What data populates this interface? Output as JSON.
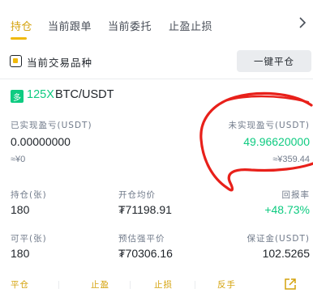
{
  "tabs": [
    {
      "label": "持仓"
    },
    {
      "label": "当前跟单"
    },
    {
      "label": "当前委托"
    },
    {
      "label": "止盈止损"
    }
  ],
  "filter": {
    "label": "当前交易品种",
    "close_all_label": "一键平仓"
  },
  "position": {
    "side_badge": "多",
    "leverage": "125X",
    "symbol": "BTC/USDT",
    "realized_pnl_label": "已实现盈亏(USDT)",
    "realized_pnl_value": "0.00000000",
    "realized_pnl_cny": "≈¥0",
    "unrealized_pnl_label": "未实现盈亏(USDT)",
    "unrealized_pnl_value": "49.96620000",
    "unrealized_pnl_cny": "≈¥359.44",
    "holding_label": "持仓(张)",
    "holding_value": "180",
    "entry_price_label": "开仓均价",
    "entry_price_value": "₮71198.91",
    "roe_label": "回报率",
    "roe_value": "+48.73%",
    "closable_label": "可平(张)",
    "closable_value": "180",
    "liq_price_label": "预估强平价",
    "liq_price_value": "₮70306.16",
    "margin_label": "保证金(USDT)",
    "margin_value": "102.5265"
  },
  "actions": [
    {
      "label": "平仓"
    },
    {
      "label": "止盈"
    },
    {
      "label": "止损"
    },
    {
      "label": "反手"
    }
  ],
  "icons": {
    "more": "chevron-right-icon",
    "share": "share-icon"
  },
  "colors": {
    "accent": "#f0b90b",
    "positive": "#0ecb81",
    "annotation": "#e8201a"
  }
}
